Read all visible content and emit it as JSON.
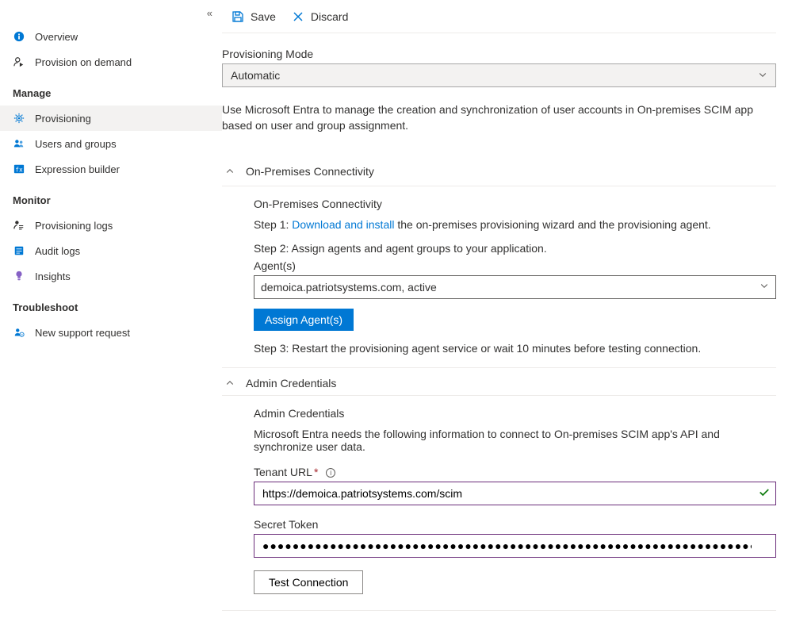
{
  "sidebar": {
    "items_top": [
      {
        "label": "Overview"
      },
      {
        "label": "Provision on demand"
      }
    ],
    "section_manage": "Manage",
    "items_manage": [
      {
        "label": "Provisioning",
        "active": true
      },
      {
        "label": "Users and groups"
      },
      {
        "label": "Expression builder"
      }
    ],
    "section_monitor": "Monitor",
    "items_monitor": [
      {
        "label": "Provisioning logs"
      },
      {
        "label": "Audit logs"
      },
      {
        "label": "Insights"
      }
    ],
    "section_troubleshoot": "Troubleshoot",
    "items_troubleshoot": [
      {
        "label": "New support request"
      }
    ]
  },
  "toolbar": {
    "save_label": "Save",
    "discard_label": "Discard"
  },
  "mode": {
    "label": "Provisioning Mode",
    "value": "Automatic",
    "description": "Use Microsoft Entra to manage the creation and synchronization of user accounts in On-premises SCIM app based on user and group assignment."
  },
  "onprem": {
    "section_title": "On-Premises Connectivity",
    "heading": "On-Premises Connectivity",
    "step1_prefix": "Step 1: ",
    "step1_link": "Download and install",
    "step1_suffix": " the on-premises provisioning wizard and the provisioning agent.",
    "step2": "Step 2: Assign agents and agent groups to your application.",
    "agents_label": "Agent(s)",
    "agents_value": "demoica.patriotsystems.com, active",
    "assign_btn": "Assign Agent(s)",
    "step3": "Step 3: Restart the provisioning agent service or wait 10 minutes before testing connection."
  },
  "creds": {
    "section_title": "Admin Credentials",
    "heading": "Admin Credentials",
    "description": "Microsoft Entra needs the following information to connect to On-premises SCIM app's API and synchronize user data.",
    "tenant_label": "Tenant URL",
    "tenant_value": "https://demoica.patriotsystems.com/scim",
    "secret_label": "Secret Token",
    "secret_value": "●●●●●●●●●●●●●●●●●●●●●●●●●●●●●●●●●●●●●●●●●●●●●●●●●●●●●●●●●●●●●●●●●●●●●●●●●●●●●●●●●●●",
    "test_btn": "Test Connection"
  }
}
